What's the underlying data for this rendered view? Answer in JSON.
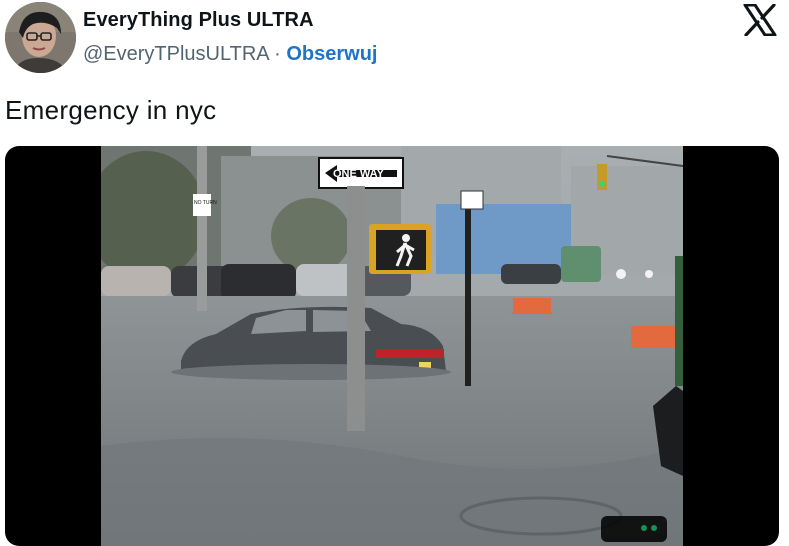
{
  "author": {
    "display_name": "EveryThing Plus ULTRA",
    "handle": "@EveryTPlusULTRA",
    "separator": "·",
    "follow_label": "Obserwuj"
  },
  "tweet": {
    "text": "Emergency in nyc"
  },
  "media": {
    "one_way_sign_text": "ONE WAY",
    "no_turn_sign_text": "NO TURN"
  },
  "icons": {
    "platform_logo": "x-logo-icon",
    "walk_signal": "walk-signal-icon"
  },
  "colors": {
    "follow_link": "#1d74c9",
    "secondary_text": "#536471",
    "primary_text": "#0f1419"
  }
}
